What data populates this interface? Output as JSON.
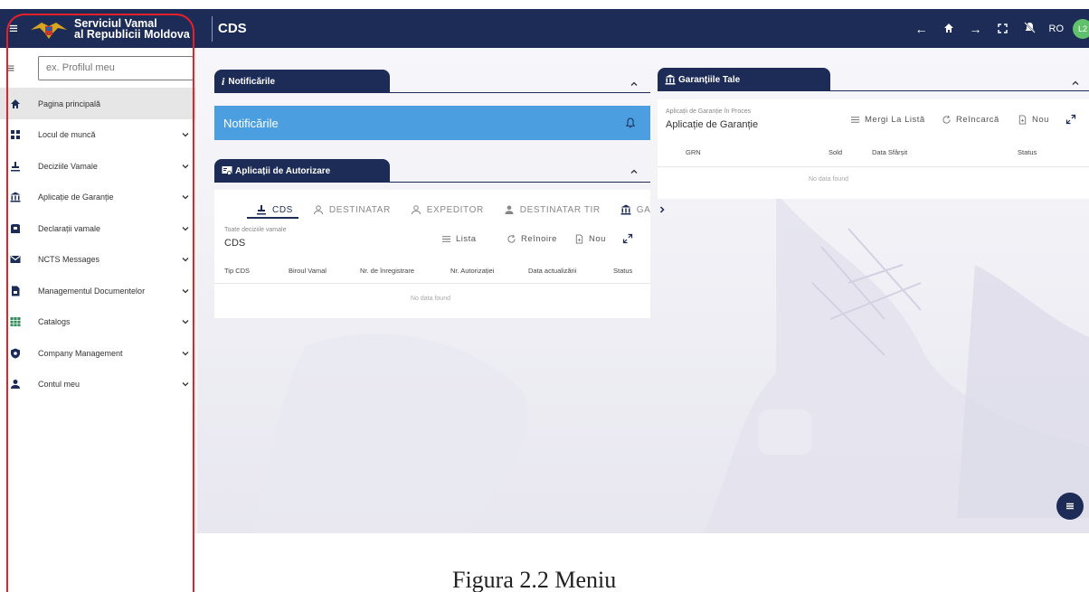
{
  "topbar": {
    "brand_line1": "Serviciul Vamal",
    "brand_line2": "al Republicii Moldova",
    "app": "CDS",
    "lang": "RO",
    "avatar": "L2"
  },
  "sidebar": {
    "search_placeholder": "ex. Profilul meu",
    "items": [
      {
        "label": "Pagina principală",
        "icon": "home-icon"
      },
      {
        "label": "Locul de muncă",
        "icon": "workplace-icon"
      },
      {
        "label": "Deciziile Vamale",
        "icon": "stamp-icon"
      },
      {
        "label": "Aplicație de Garanție",
        "icon": "bank-icon"
      },
      {
        "label": "Declarații vamale",
        "icon": "declaration-icon"
      },
      {
        "label": "NCTS Messages",
        "icon": "mail-icon"
      },
      {
        "label": "Managementul Documentelor",
        "icon": "document-icon"
      },
      {
        "label": "Catalogs",
        "icon": "table-icon"
      },
      {
        "label": "Company Management",
        "icon": "shield-icon"
      },
      {
        "label": "Contul meu",
        "icon": "user-icon"
      }
    ]
  },
  "notifications": {
    "title": "Notificările",
    "bar_label": "Notificările"
  },
  "authorizations": {
    "title": "Aplicații de Autorizare",
    "tabs": [
      "CDS",
      "DESTINATAR",
      "EXPEDITOR",
      "DESTINATAR TIR",
      "GA"
    ],
    "small_label": "Toate deciziile vamale",
    "big_label": "CDS",
    "actions": [
      "Lista",
      "Reînoire",
      "Nou"
    ],
    "columns": [
      "Tip CDS",
      "Biroul Vamal",
      "Nr. de înregistrare",
      "Nr. Autorizației",
      "Data actualizării",
      "Status"
    ],
    "empty": "No data found"
  },
  "guarantees": {
    "title": "Garanțiile Tale",
    "small_label": "Aplicații de Garanție în Proces",
    "big_label": "Aplicație de Garanție",
    "actions": [
      "Mergi La Listă",
      "Reîncarcă",
      "Nou"
    ],
    "columns": [
      "GRN",
      "Sold",
      "Data Sfârșit",
      "Status"
    ],
    "empty": "No data found"
  },
  "caption": "Figura 2.2 Meniu",
  "colors": {
    "navy": "#1c2c57",
    "notification_blue": "#4b9fe0",
    "annotation_red": "#e8202a",
    "avatar_green": "#61c06b"
  }
}
